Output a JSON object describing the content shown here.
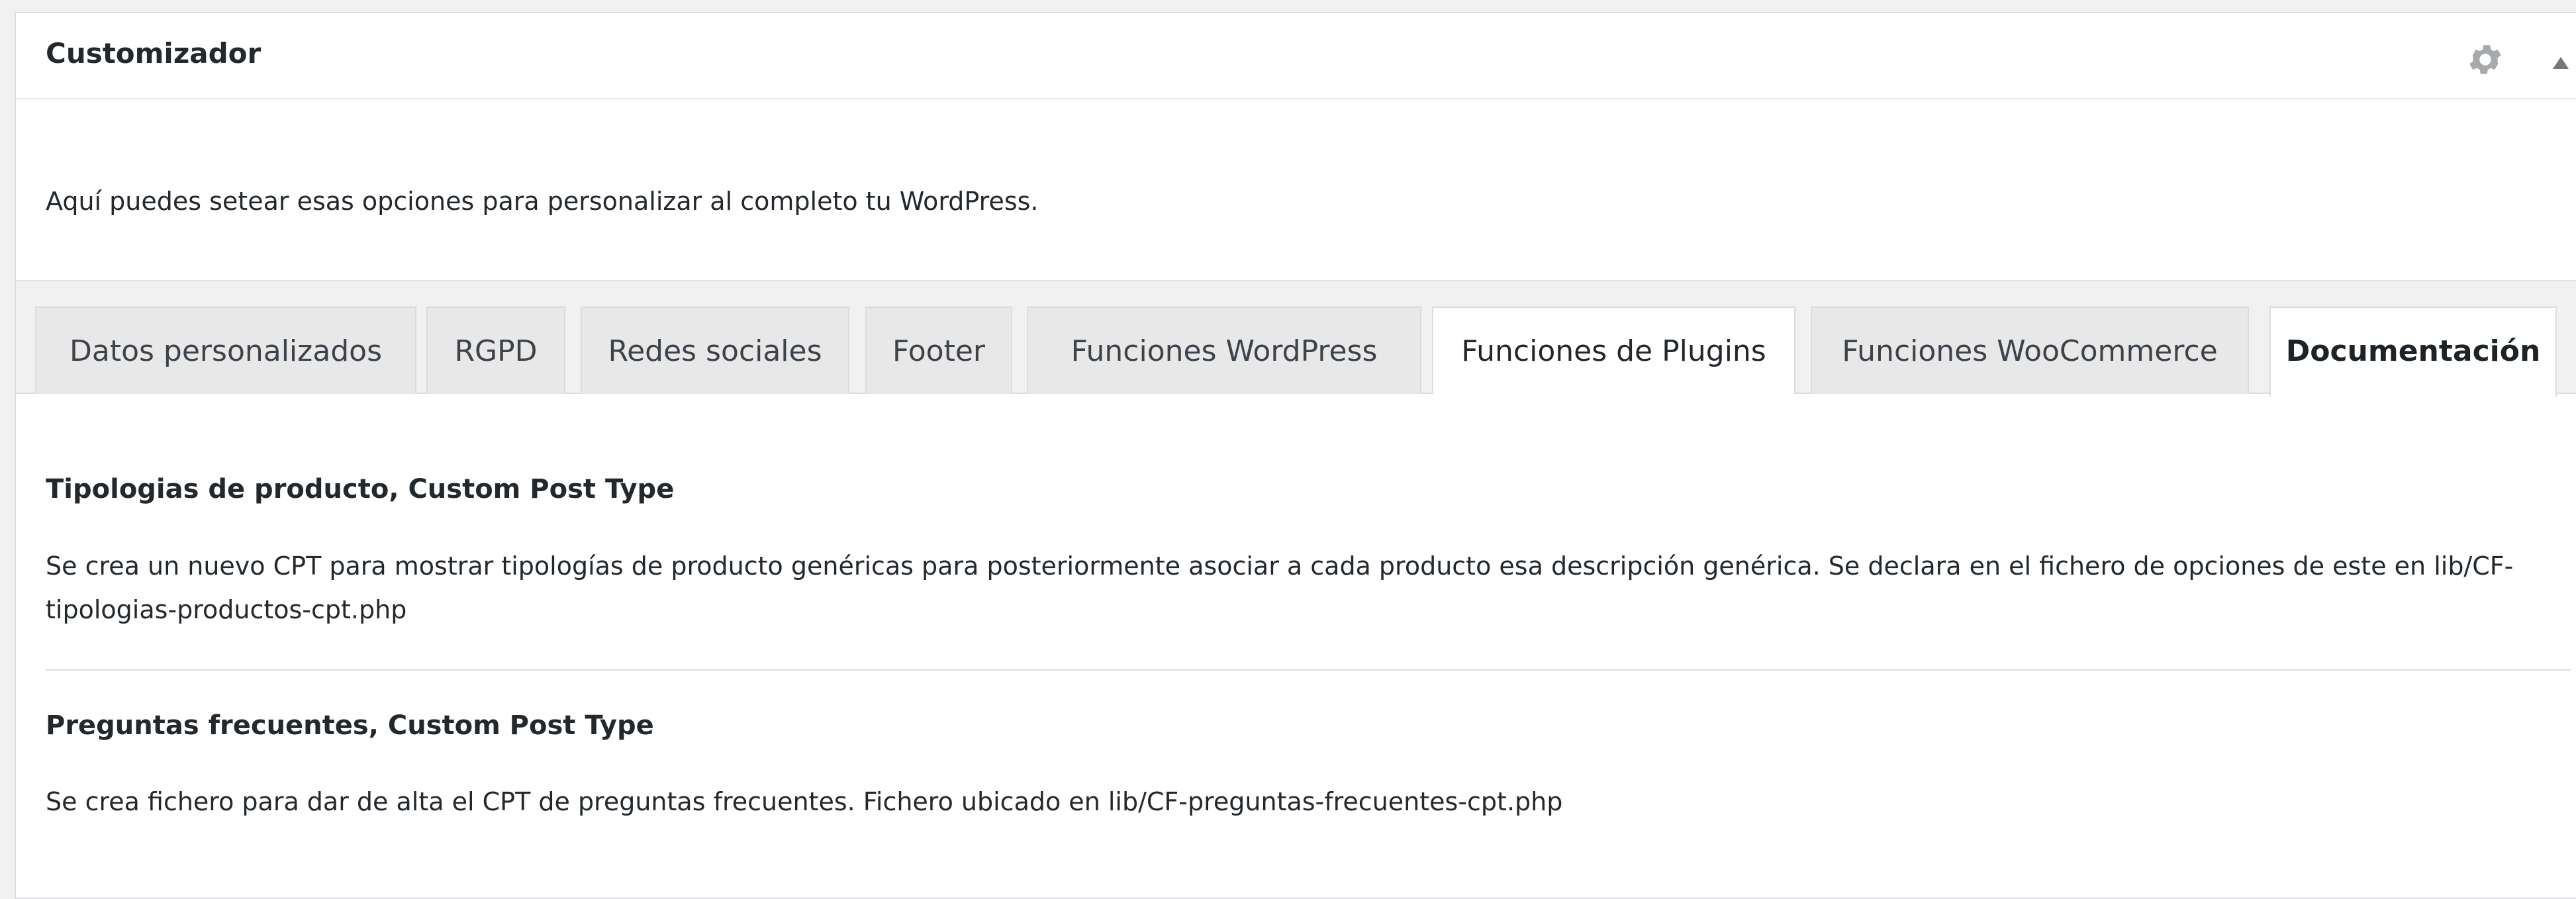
{
  "panel": {
    "title": "Customizador",
    "intro": "Aquí puedes setear esas opciones para personalizar al completo tu WordPress."
  },
  "icons": {
    "settings": "gear-icon",
    "collapse": "arrow-up-icon"
  },
  "tabs": [
    {
      "label": "Datos personalizados"
    },
    {
      "label": "RGPD"
    },
    {
      "label": "Redes sociales"
    },
    {
      "label": "Footer"
    },
    {
      "label": "Funciones WordPress"
    },
    {
      "label": "Funciones de Plugins"
    },
    {
      "label": "Funciones WooCommerce"
    },
    {
      "label": "Documentación"
    }
  ],
  "active_tab": "Documentación",
  "sections": [
    {
      "title": "Tipologias de producto, Custom Post Type",
      "text": "Se crea un nuevo CPT para mostrar tipologías de producto genéricas para posteriormente asociar a cada producto esa descripción genérica. Se declara en el fichero de opciones de este en lib/CF-tipologias-productos-cpt.php"
    },
    {
      "title": "Preguntas frecuentes, Custom Post Type",
      "text": "Se crea fichero para dar de alta el CPT de preguntas frecuentes. Fichero ubicado en lib/CF-preguntas-frecuentes-cpt.php"
    }
  ]
}
